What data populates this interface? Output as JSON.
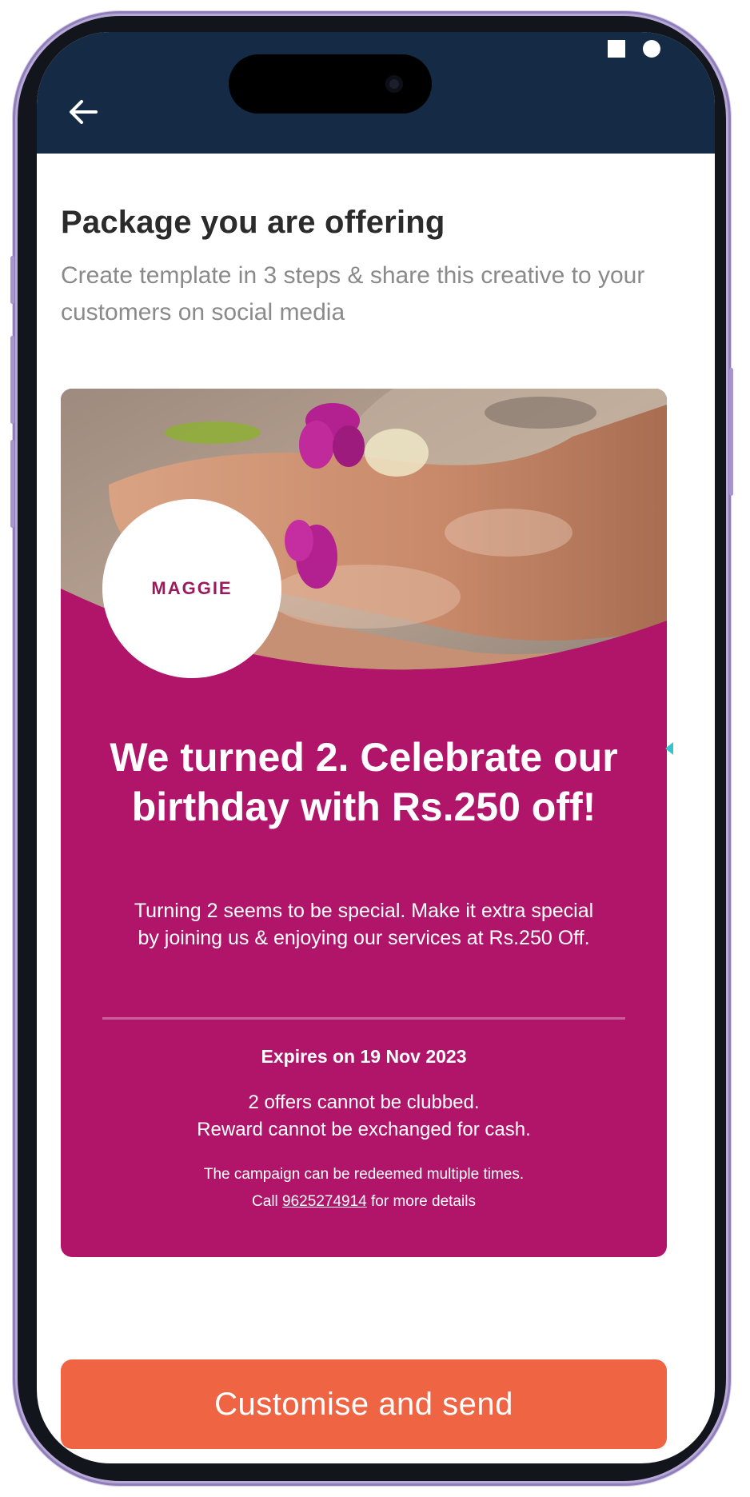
{
  "header": {
    "back_icon": "arrow-left-icon",
    "background_color": "#142a45"
  },
  "status_bar": {
    "icons": [
      "stop-square-icon",
      "record-dot-icon"
    ]
  },
  "page": {
    "title": "Package you are offering",
    "subtitle": "Create template in 3 steps & share this creative to your customers on social media"
  },
  "creative": {
    "brand_name": "MAGGIE",
    "headline": "We turned 2. Celebrate our birthday with Rs.250 off!",
    "description": "Turning 2 seems to be special. Make it extra special by joining us & enjoying our services at Rs.250 Off.",
    "expiry": "Expires on 19 Nov 2023",
    "terms_line1": "2 offers cannot be clubbed.",
    "terms_line2": "Reward cannot be exchanged for cash.",
    "fine_line1": "The campaign can be redeemed multiple times.",
    "call_prefix": "Call",
    "phone": "9625274914",
    "call_suffix": "for more details",
    "accent_color": "#b0156a"
  },
  "cta": {
    "label": "Customise and send",
    "color": "#ef6443"
  }
}
